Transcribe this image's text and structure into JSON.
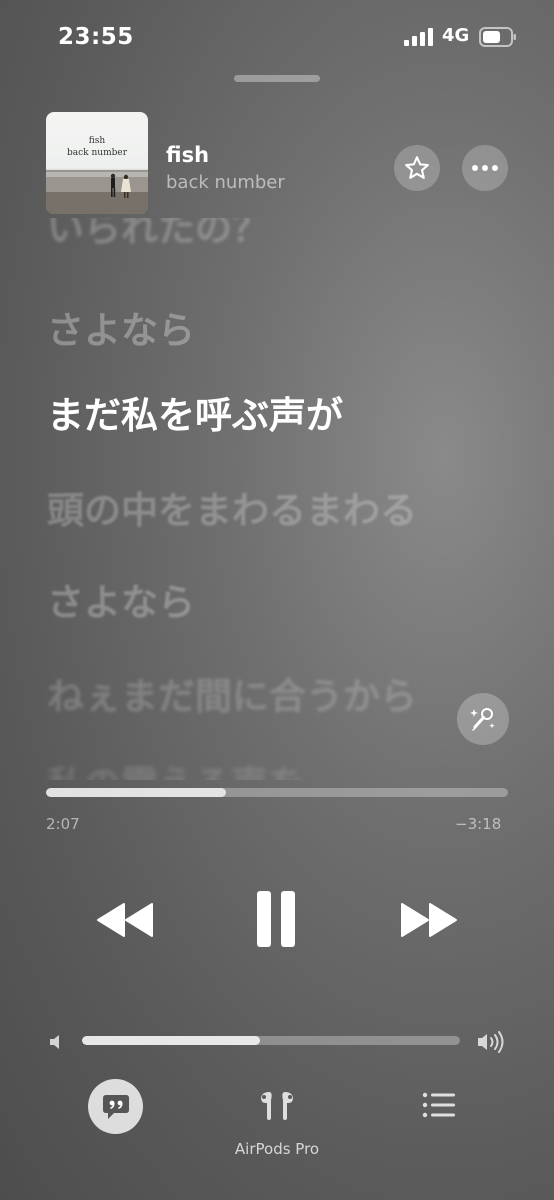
{
  "status_bar": {
    "time": "23:55",
    "network": "4G",
    "icons": [
      "signal-icon",
      "battery-icon"
    ]
  },
  "now_playing": {
    "title": "fish",
    "artist": "back number",
    "artwork": {
      "title": "fish",
      "artist": "back number"
    },
    "icons": [
      "star-icon",
      "ellipsis-icon"
    ]
  },
  "lyrics": {
    "lines": [
      "いられたの？",
      "さよなら",
      "まだ私を呼ぶ声が",
      "頭の中をまわるまわる",
      "さよなら",
      "ねぇまだ間に合うから",
      "私の震える声を"
    ],
    "active_index": 2,
    "sing_button_icon": "microphone-sparkles-icon"
  },
  "playback": {
    "elapsed": "2:07",
    "remaining": "−3:18",
    "progress_fraction": 0.39,
    "controls": [
      "rewind-icon",
      "pause-icon",
      "fast-forward-icon"
    ]
  },
  "volume": {
    "level_fraction": 0.47,
    "icons": [
      "speaker-low-icon",
      "speaker-high-icon"
    ]
  },
  "bottom_bar": {
    "lyrics_icon": "lyrics-quote-icon",
    "airplay_icon": "airpods-pro-icon",
    "airplay_label": "AirPods Pro",
    "queue_icon": "list-icon"
  },
  "colors": {
    "background": "#6a6a6a",
    "text_active": "#ffffff"
  }
}
